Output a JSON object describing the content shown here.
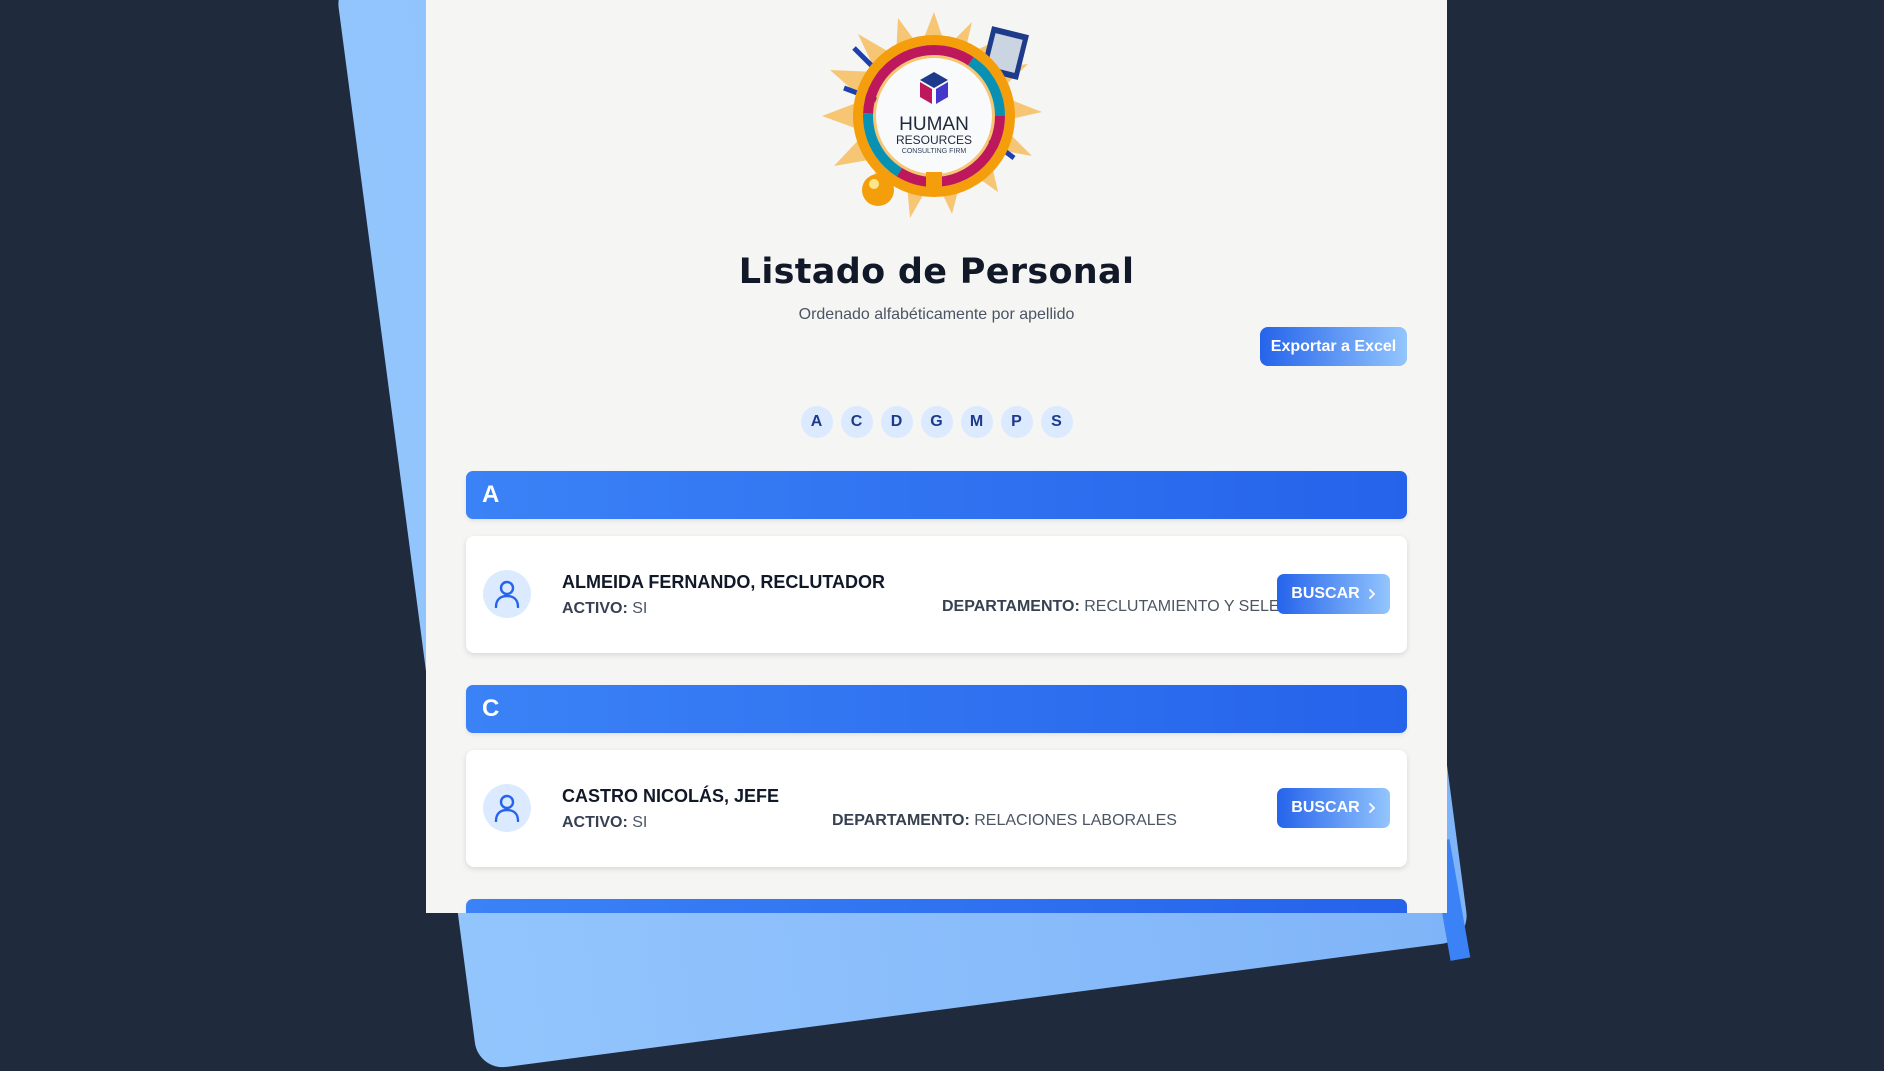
{
  "logo": {
    "line1": "HUMAN",
    "line2": "RESOURCES",
    "line3": "CONSULTING FIRM"
  },
  "header": {
    "title": "Listado de Personal",
    "subtitle": "Ordenado alfabéticamente por apellido",
    "export_label": "Exportar a Excel"
  },
  "alphabet": [
    "A",
    "C",
    "D",
    "G",
    "M",
    "P",
    "S"
  ],
  "sections": [
    {
      "letter": "A",
      "employees": [
        {
          "name": "ALMEIDA FERNANDO, RECLUTADOR",
          "active_label": "ACTIVO:",
          "active_value": "SI",
          "dept_label": "DEPARTAMENTO:",
          "dept_value": "RECLUTAMIENTO Y SELECCIÓN",
          "button_label": "BUSCAR"
        }
      ]
    },
    {
      "letter": "C",
      "employees": [
        {
          "name": "CASTRO NICOLÁS, JEFE",
          "active_label": "ACTIVO:",
          "active_value": "SI",
          "dept_label": "DEPARTAMENTO:",
          "dept_value": "RELACIONES LABORALES",
          "button_label": "BUSCAR"
        }
      ]
    }
  ],
  "colors": {
    "page_bg": "#1f2a3d",
    "sheet_bg": "#f5f5f4",
    "accent": "#2563eb",
    "accent_light": "#93c5fd"
  }
}
